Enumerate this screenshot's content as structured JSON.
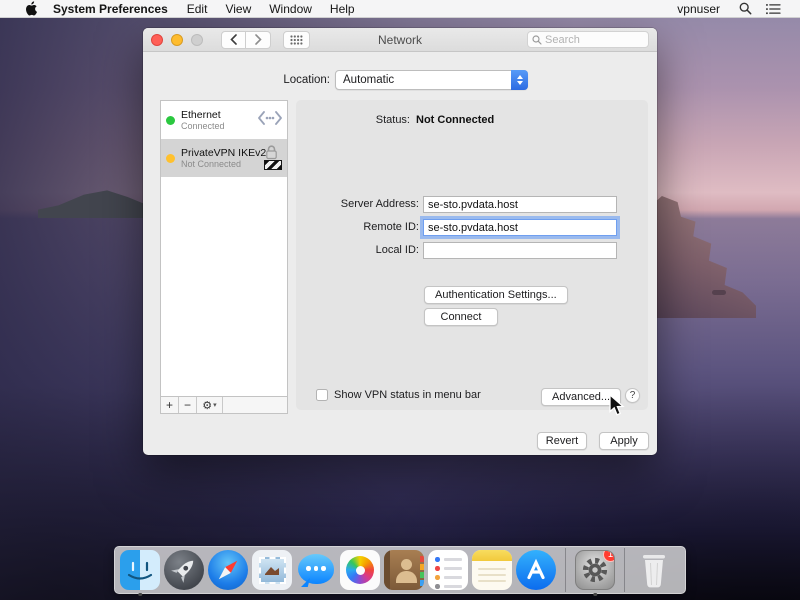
{
  "menu_bar": {
    "app_name": "System Preferences",
    "menus": [
      "Edit",
      "View",
      "Window",
      "Help"
    ],
    "username": "vpnuser"
  },
  "window": {
    "title": "Network",
    "search_placeholder": "Search",
    "location": {
      "label": "Location:",
      "value": "Automatic"
    },
    "sidebar": {
      "services": [
        {
          "name": "Ethernet",
          "status": "Connected",
          "dot_color": "#2bc840",
          "selected": false
        },
        {
          "name": "PrivateVPN IKEv2",
          "status": "Not Connected",
          "dot_color": "#ffc12e",
          "selected": true
        }
      ],
      "toolbar": {
        "add": "+",
        "remove": "−"
      }
    },
    "panel": {
      "status_label": "Status:",
      "status_value": "Not Connected",
      "fields": [
        {
          "label": "Server Address:",
          "value": "se-sto.pvdata.host",
          "focused": false
        },
        {
          "label": "Remote ID:",
          "value": "se-sto.pvdata.host",
          "focused": true
        },
        {
          "label": "Local ID:",
          "value": "",
          "focused": false
        }
      ],
      "auth_button": "Authentication Settings...",
      "connect_button": "Connect",
      "checkbox_label": "Show VPN status in menu bar",
      "checkbox_checked": false,
      "advanced_button": "Advanced...",
      "help_button": "?"
    },
    "revert_button": "Revert",
    "apply_button": "Apply"
  },
  "dock": {
    "badge": "1",
    "items": [
      "finder",
      "launchpad",
      "safari",
      "mail",
      "messages",
      "photos",
      "contacts",
      "reminders",
      "notes",
      "app-store",
      "system-preferences",
      "trash"
    ],
    "running": [
      "finder",
      "system-preferences"
    ]
  },
  "colors": {
    "accent": "#2d6be2",
    "focus_ring": "#5c98f5",
    "selected_row": "#d4d4d4",
    "status_connected_dot": "#2bc840",
    "status_warning_dot": "#ffc12e",
    "badge_red": "#ff3b30"
  }
}
